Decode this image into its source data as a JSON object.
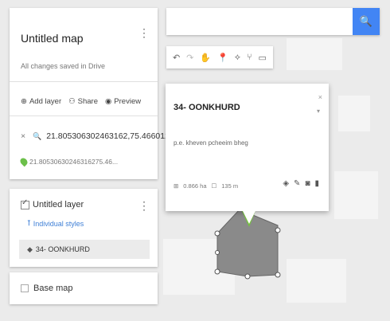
{
  "panel": {
    "map_title": "Untitled map",
    "saved_status": "All changes saved in Drive",
    "menu_glyph": "⋮",
    "actions": [
      {
        "icon": "add-layer-icon",
        "glyph": "⊕",
        "label": "Add layer"
      },
      {
        "icon": "share-icon",
        "glyph": "⚇",
        "label": "Share"
      },
      {
        "icon": "preview-icon",
        "glyph": "◉",
        "label": "Preview"
      }
    ],
    "search_result": {
      "close_glyph": "×",
      "search_glyph": "🔍",
      "query": "21.8053063024631​62,75.466012...",
      "pin_label": "21.80530630246316275.46..."
    }
  },
  "layer": {
    "title": "Untitled layer",
    "menu_glyph": "⋮",
    "style_label": "Individual styles",
    "feature_label": "34- OONKHURD"
  },
  "base_map": {
    "label": "Base map"
  },
  "search": {
    "button_glyph": "🔍"
  },
  "toolbar": {
    "tools": [
      {
        "name": "undo-icon",
        "glyph": "↶"
      },
      {
        "name": "redo-icon",
        "glyph": "↷"
      },
      {
        "name": "hand-icon",
        "glyph": "✋"
      },
      {
        "name": "marker-icon",
        "glyph": "📍"
      },
      {
        "name": "draw-line-icon",
        "glyph": "⟡"
      },
      {
        "name": "directions-icon",
        "glyph": "⑂"
      },
      {
        "name": "ruler-icon",
        "glyph": "▭"
      }
    ]
  },
  "card": {
    "title": "34- OONKHURD",
    "description": "p.e. kheven pcheeim bheg",
    "close_glyph": "×",
    "collapse_glyph": "▾",
    "area": "0.866 ha",
    "perimeter": "135 m",
    "tool_glyphs": {
      "style": "◈",
      "edit": "✎",
      "photo": "◙",
      "delete": "▮"
    }
  },
  "colors": {
    "accent": "#4285f4",
    "polygon_fill": "#8a8a8a",
    "polygon_highlight": "#77c043"
  }
}
